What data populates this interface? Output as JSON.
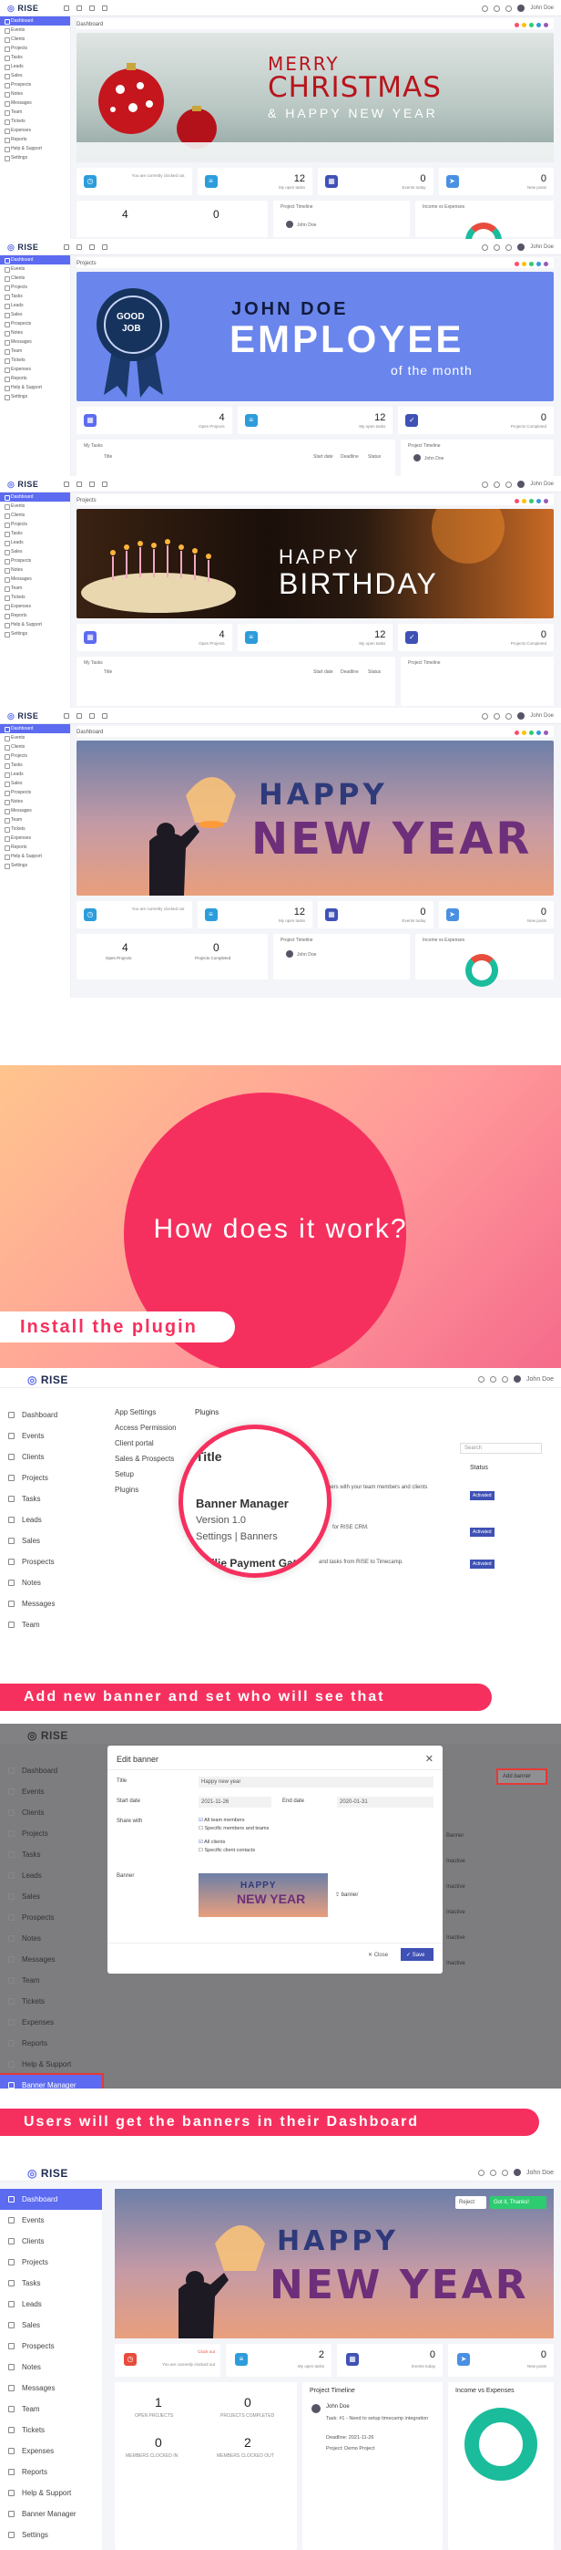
{
  "brand": {
    "logo_text": "RISE",
    "user_name": "John Doe"
  },
  "sidebar_items": [
    "Dashboard",
    "Events",
    "Clients",
    "Projects",
    "Tasks",
    "Leads",
    "Sales",
    "Prospects",
    "Notes",
    "Messages",
    "Team",
    "Tickets",
    "Expenses",
    "Reports",
    "Help & Support",
    "Settings"
  ],
  "sidebar_items_ext": [
    "Dashboard",
    "Events",
    "Clients",
    "Projects",
    "Tasks",
    "Leads",
    "Sales",
    "Prospects",
    "Notes",
    "Messages",
    "Team",
    "Tickets",
    "Expenses",
    "Reports",
    "Help & Support",
    "Banner Manager",
    "Settings"
  ],
  "shots": [
    {
      "title": "Dashboard",
      "banner_line1": "MERRY",
      "banner_line2": "CHRISTMAS",
      "banner_line3": "& HAPPY NEW YEAR"
    },
    {
      "title": "Projects",
      "badge_l1": "GOOD",
      "badge_l2": "JOB",
      "banner_name": "JOHN DOE",
      "banner_main": "EMPLOYEE",
      "banner_sub": "of the month"
    },
    {
      "title": "Projects",
      "banner_l1": "HAPPY",
      "banner_l2": "BIRTHDAY"
    },
    {
      "title": "Dashboard",
      "banner_l1": "HAPPY",
      "banner_l2": "NEW YEAR"
    }
  ],
  "stats": {
    "clock_status": "Clock out",
    "clock_sub": "You are currently clocked out",
    "open_tasks": "12",
    "open_tasks_lbl": "My open tasks",
    "events": "0",
    "events_lbl": "Events today",
    "new_posts": "0",
    "new_posts_lbl": "New posts",
    "open_projects": "4",
    "open_projects_lbl": "Open Projects",
    "completed": "0",
    "completed_lbl": "Projects Completed"
  },
  "cards": {
    "timeline": "Project Timeline",
    "income": "Income vs Expenses",
    "tasks": "My Tasks",
    "col_title": "Title",
    "col_start": "Start date",
    "col_deadline": "Deadline",
    "col_status": "Status"
  },
  "howto": {
    "heading": "How does it work?",
    "step1": "Install the plugin",
    "step2": "Add new banner and set who will see that",
    "step3": "Users will get the banners in their Dashboard"
  },
  "plugins_screen": {
    "menu": [
      "App Settings",
      "Access Permission",
      "Client portal",
      "Sales & Prospects",
      "Setup",
      "Plugins"
    ],
    "header": "Plugins",
    "zoom_title": "Title",
    "plugin_name": "Banner Manager",
    "plugin_version": "Version 1.0",
    "link_settings": "Settings",
    "link_banners": "Banners",
    "plugin2": "Mollie Payment Gateway",
    "search": "Search",
    "status_col": "Status",
    "status": "Activated",
    "desc1": "banners with your team members and clients",
    "desc2": "for RISE CRM.",
    "desc3": "and tasks from RISE to Timecamp."
  },
  "modal": {
    "title": "Edit banner",
    "f_title": "Title",
    "v_title": "Happy new year",
    "f_start": "Start date",
    "v_start": "2021-11-26",
    "f_end": "End date",
    "v_end": "2020-01-31",
    "f_share": "Share with",
    "opt1": "All team members",
    "opt2": "Specific members and teams",
    "opt3": "All clients",
    "opt4": "Specific client contacts",
    "f_banner": "Banner",
    "banner_file": "banner",
    "close": "Close",
    "save": "Save",
    "add_btn": "Add banner",
    "side_rows": [
      "Banner",
      "Inactive",
      "Inactive",
      "Inactive",
      "Inactive",
      "Inactive"
    ]
  },
  "final": {
    "reject": "Reject",
    "thanks": "Got it, Thanks!",
    "open_tasks": "2",
    "open_projects": "1",
    "completed": "0",
    "members_clocked_in": "0",
    "members_clocked_out": "2",
    "members_in_lbl": "MEMBERS CLOCKED IN",
    "members_out_lbl": "MEMBERS CLOCKED OUT",
    "open_projects_lbl": "OPEN PROJECTS",
    "completed_lbl": "PROJECTS COMPLETED",
    "tl_user": "John Doe",
    "tl_task": "Task: #1 - Need to setup timecamp integration",
    "tl_deadline": "Deadline: 2021-11-26",
    "tl_project": "Project: Demo Project"
  }
}
